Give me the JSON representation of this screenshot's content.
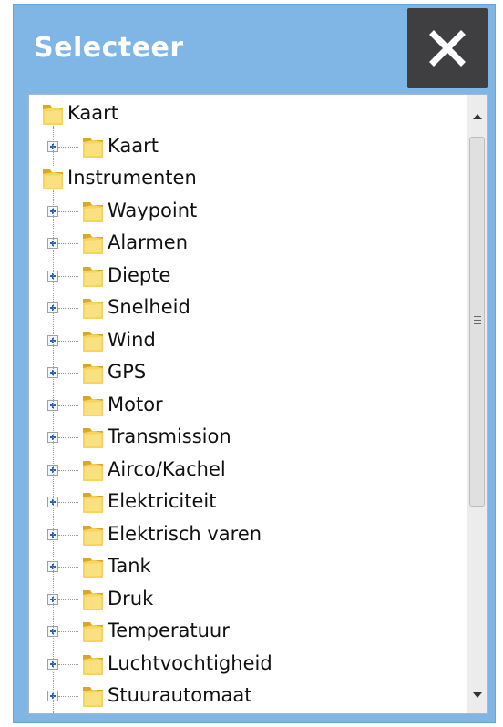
{
  "dialog": {
    "title": "Selecteer",
    "close_icon": "close-icon",
    "background_color": "#7fb6e6"
  },
  "tree": {
    "nodes": [
      {
        "label": "Kaart",
        "level": 0,
        "expandable": false,
        "icon": "folder-icon"
      },
      {
        "label": "Kaart",
        "level": 1,
        "expandable": true,
        "icon": "folder-icon"
      },
      {
        "label": "Instrumenten",
        "level": 0,
        "expandable": false,
        "icon": "folder-icon"
      },
      {
        "label": "Waypoint",
        "level": 1,
        "expandable": true,
        "icon": "folder-icon"
      },
      {
        "label": "Alarmen",
        "level": 1,
        "expandable": true,
        "icon": "folder-icon"
      },
      {
        "label": "Diepte",
        "level": 1,
        "expandable": true,
        "icon": "folder-icon"
      },
      {
        "label": "Snelheid",
        "level": 1,
        "expandable": true,
        "icon": "folder-icon"
      },
      {
        "label": "Wind",
        "level": 1,
        "expandable": true,
        "icon": "folder-icon"
      },
      {
        "label": "GPS",
        "level": 1,
        "expandable": true,
        "icon": "folder-icon"
      },
      {
        "label": "Motor",
        "level": 1,
        "expandable": true,
        "icon": "folder-icon"
      },
      {
        "label": "Transmission",
        "level": 1,
        "expandable": true,
        "icon": "folder-icon"
      },
      {
        "label": "Airco/Kachel",
        "level": 1,
        "expandable": true,
        "icon": "folder-icon"
      },
      {
        "label": "Elektriciteit",
        "level": 1,
        "expandable": true,
        "icon": "folder-icon"
      },
      {
        "label": "Elektrisch varen",
        "level": 1,
        "expandable": true,
        "icon": "folder-icon"
      },
      {
        "label": "Tank",
        "level": 1,
        "expandable": true,
        "icon": "folder-icon"
      },
      {
        "label": "Druk",
        "level": 1,
        "expandable": true,
        "icon": "folder-icon"
      },
      {
        "label": "Temperatuur",
        "level": 1,
        "expandable": true,
        "icon": "folder-icon"
      },
      {
        "label": "Luchtvochtigheid",
        "level": 1,
        "expandable": true,
        "icon": "folder-icon"
      },
      {
        "label": "Stuurautomaat",
        "level": 1,
        "expandable": true,
        "icon": "folder-icon"
      }
    ]
  },
  "scrollbar": {
    "up_icon": "scroll-up-arrow-icon",
    "down_icon": "scroll-down-arrow-icon",
    "thumb_grip_icon": "grip-icon"
  },
  "colors": {
    "folder_light": "#f7d45c",
    "folder_dark": "#d9a82a",
    "close_button": "#3f3f41"
  }
}
